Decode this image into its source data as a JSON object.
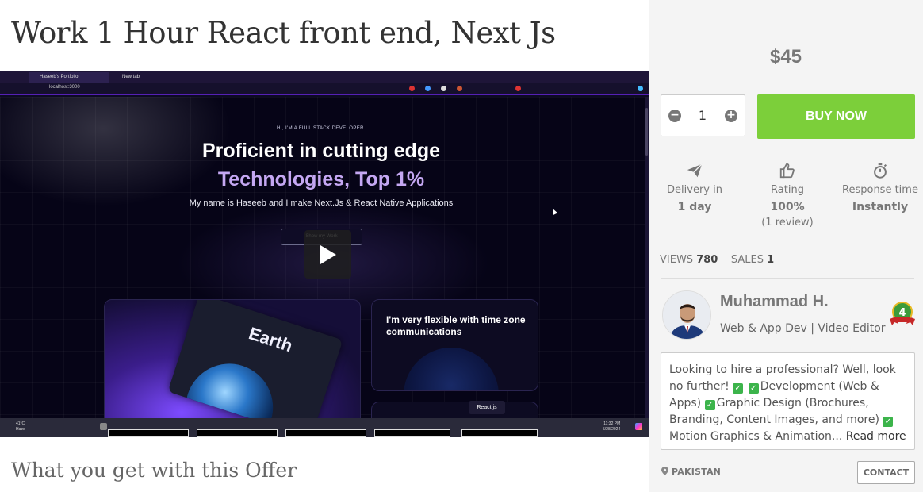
{
  "offer": {
    "title": "Work 1 Hour React front end, Next Js",
    "section_heading": "What you get with this Offer"
  },
  "video": {
    "browser": {
      "tabs": [
        "Haseeb's Portfolio",
        "New tab"
      ],
      "address": "localhost:3000"
    },
    "site": {
      "eyebrow": "HI, I'M A FULL STACK DEVELOPER.",
      "headline_1": "Proficient in cutting edge",
      "headline_2": "Technologies, Top 1%",
      "subtitle": "My name is Haseeb and I make Next.Js & React Native Applications",
      "cta": "Show my Work",
      "card_earth": "Earth",
      "card_flexible": "I'm very flexible with time zone communications",
      "react_tag": "React.js"
    },
    "taskbar": {
      "weather_temp": "41°C",
      "weather_desc": "Haze",
      "time": "11:32 PM",
      "date": "5/28/2024"
    }
  },
  "purchase": {
    "price": "$45",
    "quantity": "1",
    "buy_label": "BUY NOW"
  },
  "stats": [
    {
      "icon": "paper-plane-icon",
      "label": "Delivery in",
      "value": "1 day",
      "extra": ""
    },
    {
      "icon": "thumbs-up-icon",
      "label": "Rating",
      "value": "100%",
      "extra": "(1 review)"
    },
    {
      "icon": "stopwatch-icon",
      "label": "Response time",
      "value": "Instantly",
      "extra": ""
    }
  ],
  "counts": {
    "views_label": "VIEWS",
    "views_value": "780",
    "sales_label": "SALES",
    "sales_value": "1"
  },
  "seller": {
    "name": "Muhammad H.",
    "tagline": "Web & App Dev | Video Editor",
    "level": "4",
    "bio_intro": "Looking to hire a professional? Well, look no further!",
    "bio_items": [
      "Development (Web & Apps)",
      "Graphic Design (Brochures, Branding, Content Images, and more)",
      "Motion Graphics & Animation..."
    ],
    "read_more": "Read more",
    "country": "PAKISTAN",
    "contact_label": "CONTACT"
  },
  "colors": {
    "buy_button": "#7ccf3a",
    "sidebar_bg": "#f4f4f4",
    "check_green": "#3cb44b",
    "headline_purple": "#c4a7f2"
  }
}
